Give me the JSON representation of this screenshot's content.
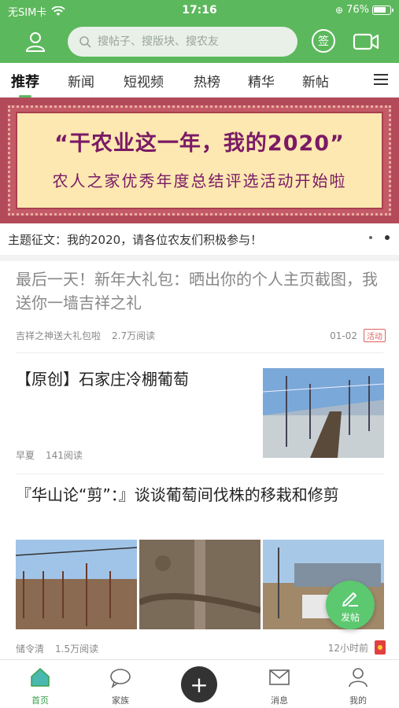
{
  "status": {
    "carrier": "无SIM卡",
    "time": "17:16",
    "battery": "76%"
  },
  "header": {
    "search_placeholder": "搜帖子、搜版块、搜农友",
    "sign_label": "签"
  },
  "tabs": [
    "推荐",
    "新闻",
    "短视频",
    "热榜",
    "精华",
    "新帖"
  ],
  "banner": {
    "line1": "“干农业这一年，我的2020”",
    "line2": "农人之家优秀年度总结评选活动开始啦"
  },
  "topic": "主题征文：我的2020，请各位农友们积极参与！",
  "posts": [
    {
      "title": "最后一天！新年大礼包：晒出你的个人主页截图，我送你一墙吉祥之礼",
      "author": "吉祥之神送大礼包啦",
      "reads": "2.7万阅读",
      "date": "01-02",
      "badge": "活动"
    },
    {
      "title": "【原创】石家庄冷棚葡萄",
      "author": "早夏",
      "reads": "141阅读"
    },
    {
      "title": "『华山论“剪”：』谈谈葡萄间伐株的移栽和修剪",
      "author": "储令清",
      "reads": "1.5万阅读",
      "time": "12小时前"
    }
  ],
  "fab_label": "发帖",
  "nav": {
    "home": "首页",
    "family": "家族",
    "messages": "消息",
    "mine": "我的"
  },
  "colors": {
    "brand": "#5cb85c",
    "active_nav": "#3aa04a"
  }
}
